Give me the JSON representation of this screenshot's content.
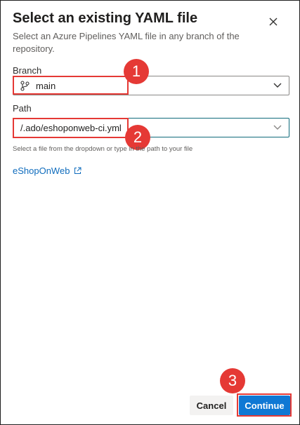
{
  "dialog": {
    "title": "Select an existing YAML file",
    "subtitle": "Select an Azure Pipelines YAML file in any branch of the repository."
  },
  "branch": {
    "label": "Branch",
    "value": "main",
    "icon": "branch-icon"
  },
  "path": {
    "label": "Path",
    "value": "/.ado/eshoponweb-ci.yml",
    "hint": "Select a file from the dropdown or type in the path to your file"
  },
  "repository": {
    "link_label": "eShopOnWeb",
    "icon": "external-link-icon"
  },
  "buttons": {
    "cancel": "Cancel",
    "continue": "Continue"
  },
  "annotations": {
    "step1": "1",
    "step2": "2",
    "step3": "3",
    "color": "#e53935"
  },
  "colors": {
    "primary": "#0f78d4",
    "link": "#0f6cbd",
    "focus_border": "#0f6a7a"
  }
}
